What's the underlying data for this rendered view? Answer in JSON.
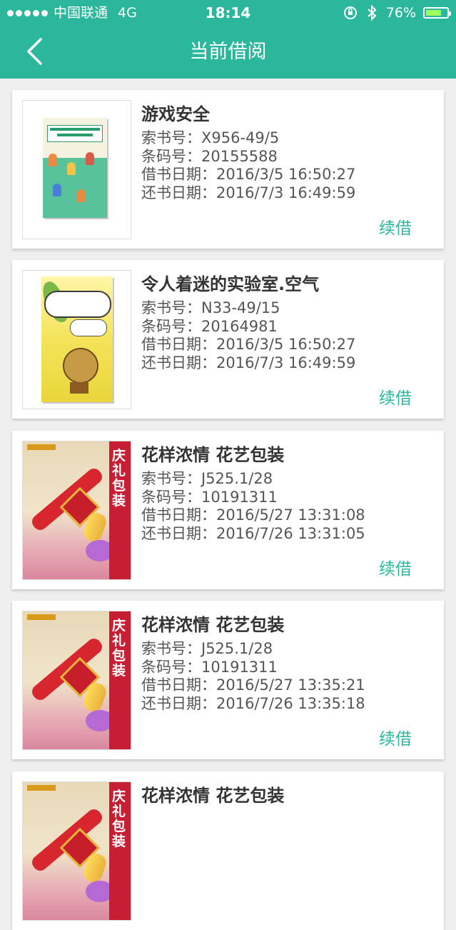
{
  "status_bar": {
    "carrier": "中国联通",
    "network": "4G",
    "time": "18:14",
    "battery_text": "76%",
    "battery_level": 0.76,
    "icons": [
      "signal-dots-icon",
      "orientation-lock-icon",
      "bluetooth-icon",
      "battery-icon"
    ]
  },
  "nav": {
    "title": "当前借阅",
    "back_icon": "chevron-left-icon"
  },
  "labels": {
    "call_number": "索书号：",
    "barcode": "条码号：",
    "borrow_date": "借书日期：",
    "return_date": "还书日期：",
    "renew": "续借"
  },
  "books": [
    {
      "title": "游戏安全",
      "call_number": "X956-49/5",
      "barcode": "20155588",
      "borrow_date": "2016/3/5 16:50:27",
      "return_date": "2016/7/3 16:49:59",
      "cover_style": "green"
    },
    {
      "title": "令人着迷的实验室.空气",
      "call_number": "N33-49/15",
      "barcode": "20164981",
      "borrow_date": "2016/3/5 16:50:27",
      "return_date": "2016/7/3 16:49:59",
      "cover_style": "yellow"
    },
    {
      "title": "花样浓情 花艺包装",
      "call_number": "J525.1/28",
      "barcode": "10191311",
      "borrow_date": "2016/5/27 13:31:08",
      "return_date": "2016/7/26 13:31:05",
      "cover_style": "red",
      "cover_text": "庆礼包装"
    },
    {
      "title": "花样浓情 花艺包装",
      "call_number": "J525.1/28",
      "barcode": "10191311",
      "borrow_date": "2016/5/27 13:35:21",
      "return_date": "2016/7/26 13:35:18",
      "cover_style": "red",
      "cover_text": "庆礼包装"
    },
    {
      "title": "花样浓情 花艺包装",
      "cover_style": "red",
      "cover_text": "庆礼包装"
    }
  ],
  "colors": {
    "accent": "#2bb79c",
    "background": "#efefef"
  }
}
